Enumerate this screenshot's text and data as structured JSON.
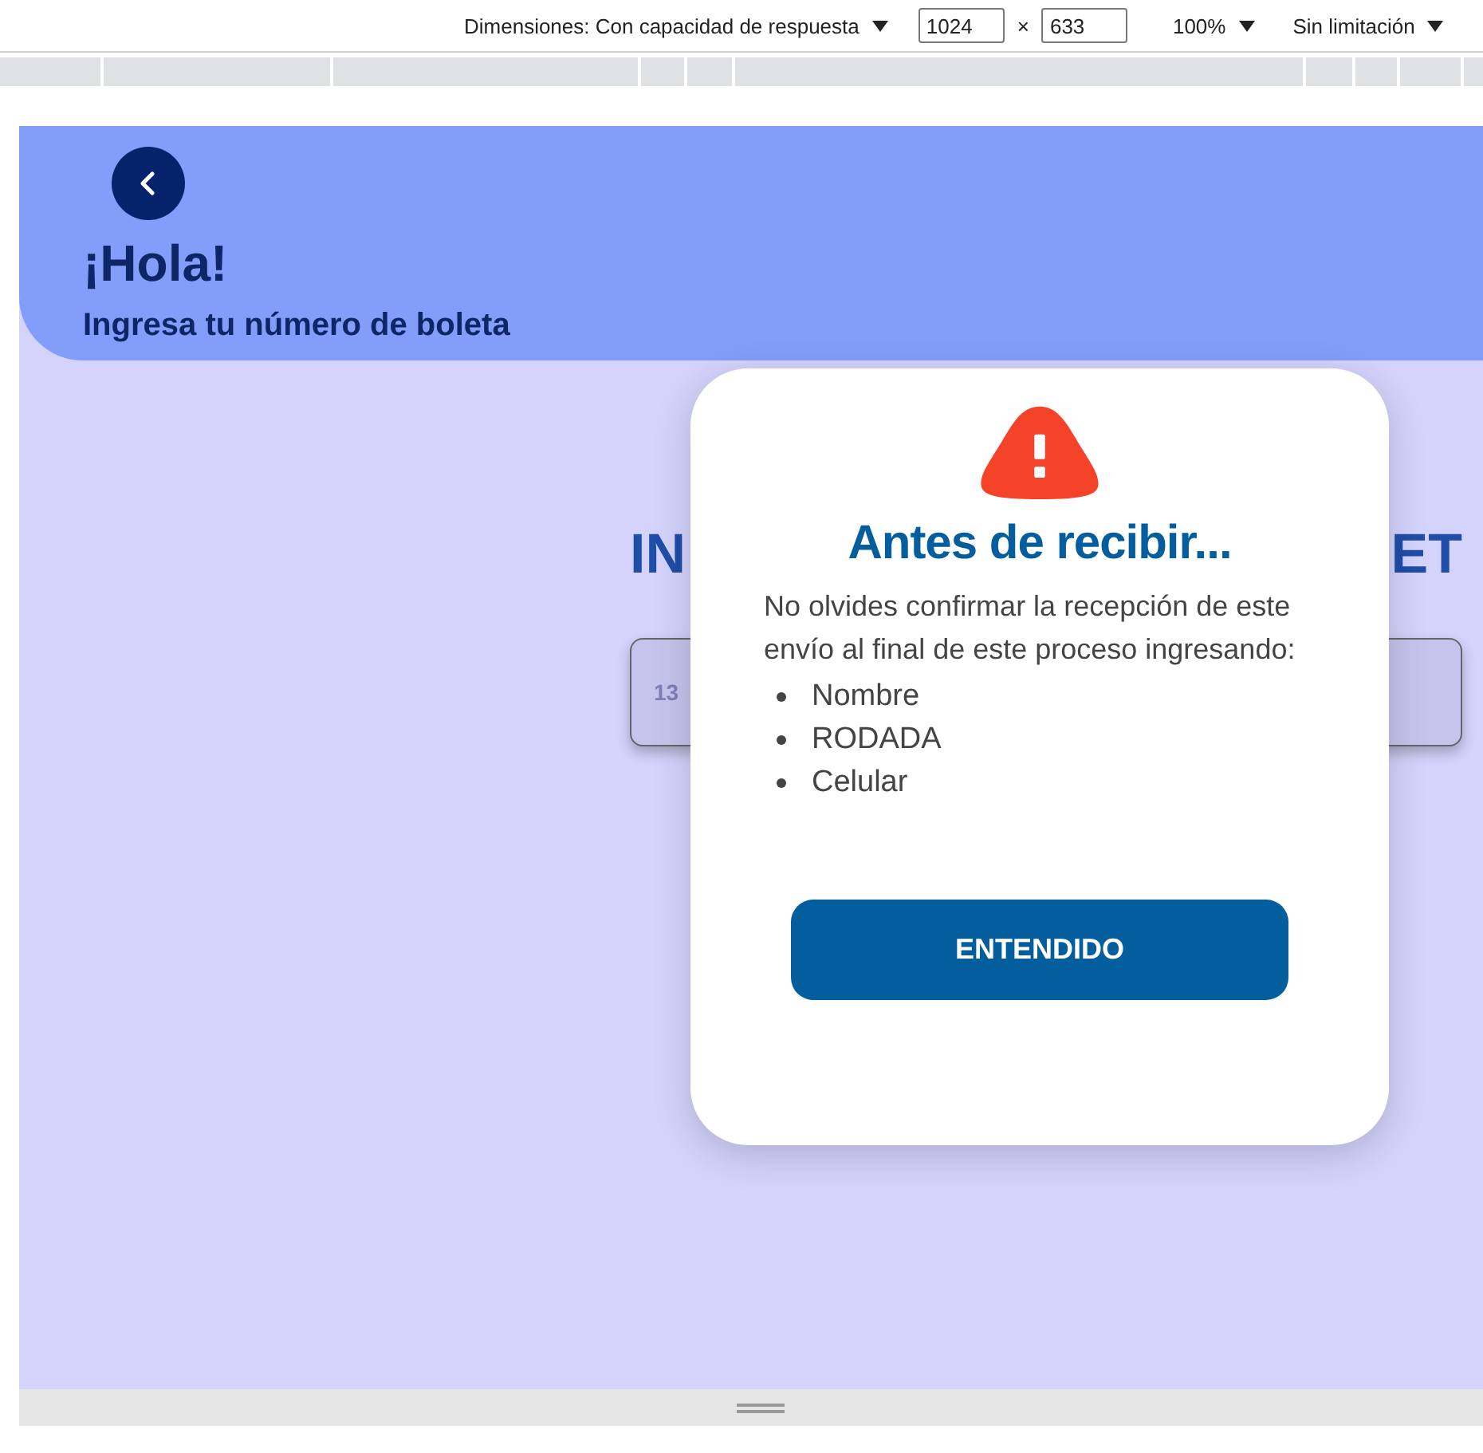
{
  "devtools_bar": {
    "dimensions_label": "Dimensiones: Con capacidad de respuesta",
    "width_value": "1024",
    "times_sign": "×",
    "height_value": "633",
    "zoom": "100%",
    "throttling": "Sin limitación"
  },
  "header": {
    "title": "¡Hola!",
    "subtitle": "Ingresa tu número de boleta"
  },
  "page": {
    "heading_left": "IN",
    "heading_right": "ET",
    "field_text": "13"
  },
  "modal": {
    "title": "Antes de recibir...",
    "message": "No olvides confirmar la recepción de este envío al final de este proceso ingresando:",
    "items": [
      "Nombre",
      "RODADA",
      "Celular"
    ],
    "button": "ENTENDIDO"
  }
}
